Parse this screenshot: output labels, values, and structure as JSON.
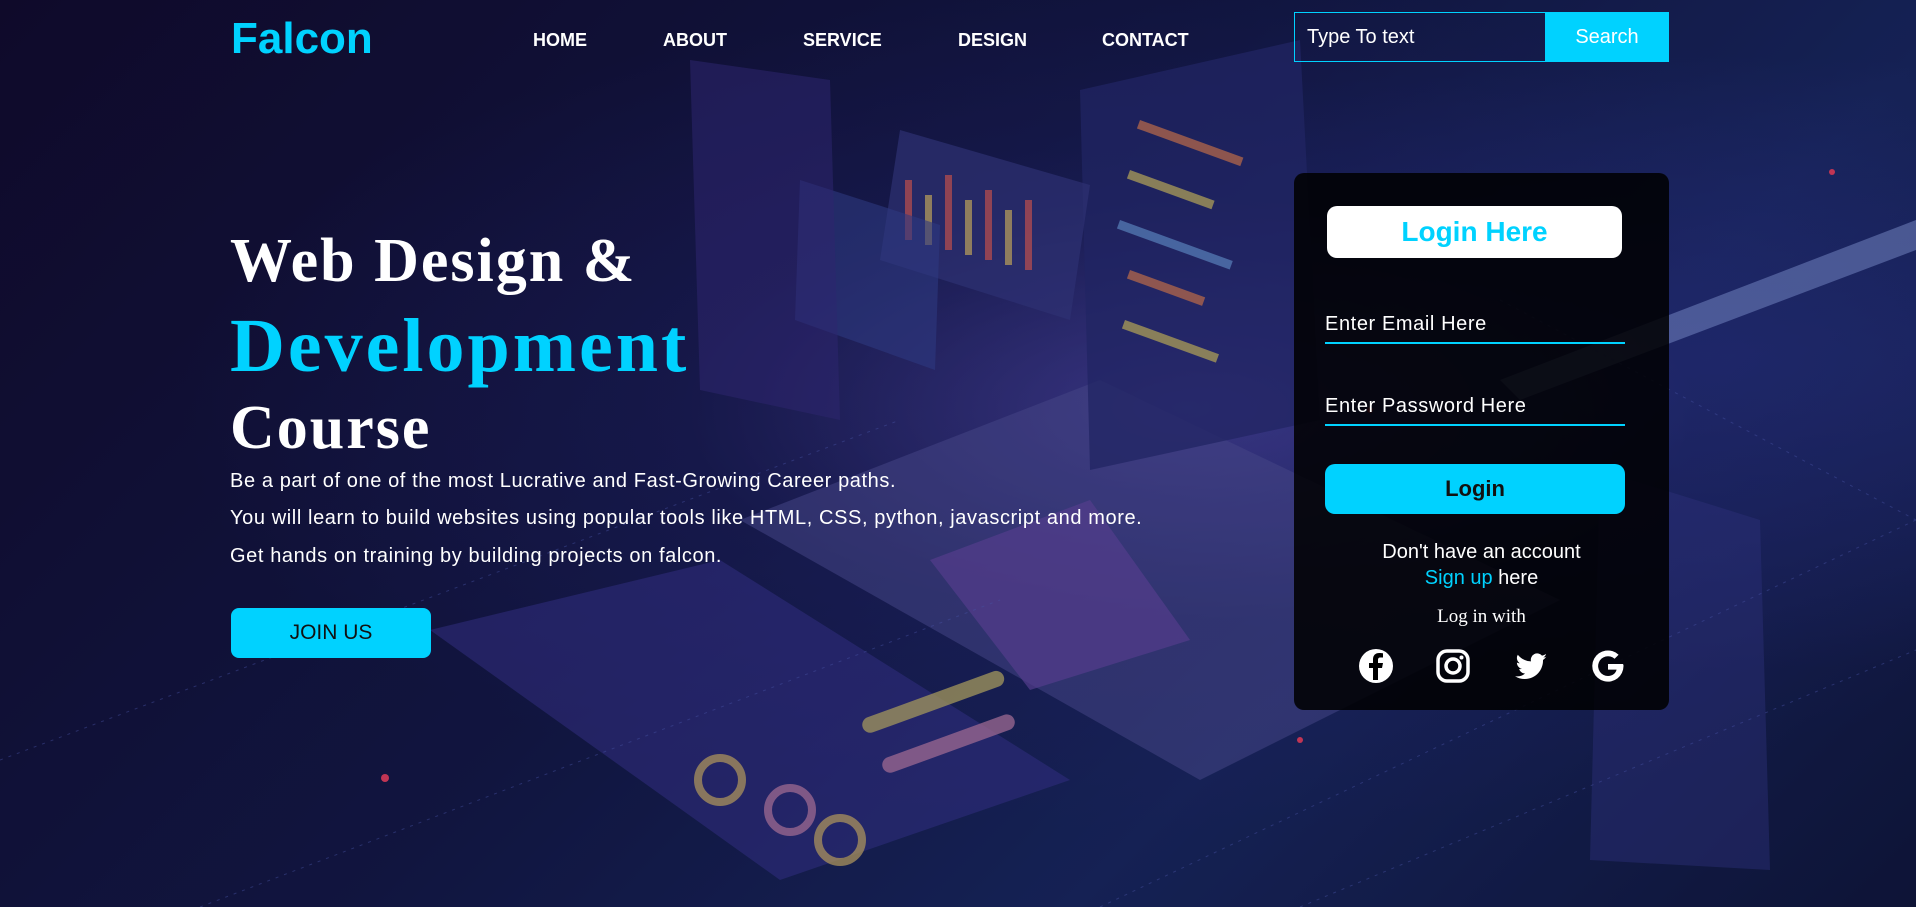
{
  "header": {
    "logo": "Falcon",
    "nav": [
      "HOME",
      "ABOUT",
      "SERVICE",
      "DESIGN",
      "CONTACT"
    ],
    "search": {
      "placeholder": "Type To text",
      "button_label": "Search"
    }
  },
  "hero": {
    "line1": "Web Design &",
    "line2": "Development",
    "line3": "Course",
    "paragraphs": [
      "Be a part of one of the most Lucrative and Fast-Growing Career paths.",
      "You will learn to build websites using popular tools like HTML, CSS, python, javascript and more.",
      "Get hands on training by building projects on falcon."
    ],
    "join_label": "JOIN US"
  },
  "login": {
    "title": "Login Here",
    "email_placeholder": "Enter Email Here",
    "password_placeholder": "Enter Password Here",
    "login_label": "Login",
    "no_account": "Don't have an account",
    "signup_link": "Sign up",
    "signup_suffix": " here",
    "log_in_with": "Log in with",
    "social_icons": [
      "facebook-icon",
      "instagram-icon",
      "twitter-icon",
      "google-icon"
    ]
  },
  "colors": {
    "accent": "#00d2ff",
    "card_bg": "#000000",
    "text": "#ffffff"
  }
}
